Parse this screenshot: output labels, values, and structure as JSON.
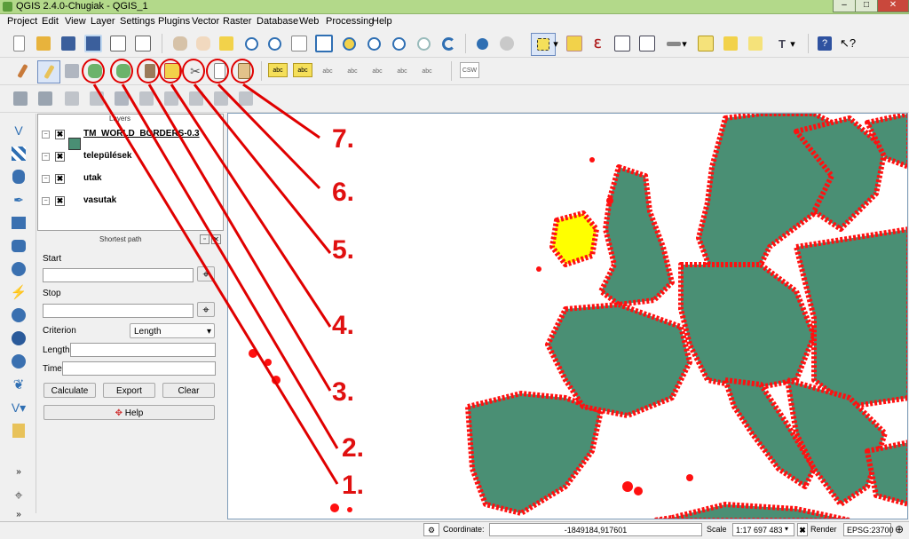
{
  "window": {
    "title": "QGIS 2.4.0-Chugiak - QGIS_1",
    "minimize": "–",
    "maximize": "□",
    "close": "✕"
  },
  "menu": [
    "Project",
    "Edit",
    "View",
    "Layer",
    "Settings",
    "Plugins",
    "Vector",
    "Raster",
    "Database",
    "Web",
    "Processing",
    "Help"
  ],
  "layers_panel": {
    "title": "Layers",
    "layers": [
      {
        "name": "TM_WORLD_BORDERS-0.3",
        "checked": "✖",
        "swatch": "#4a8f74"
      },
      {
        "name": "települések",
        "checked": "✖"
      },
      {
        "name": "utak",
        "checked": "✖"
      },
      {
        "name": "vasutak",
        "checked": "✖"
      }
    ]
  },
  "shortest_path": {
    "title": "Shortest path",
    "start_label": "Start",
    "stop_label": "Stop",
    "criterion_label": "Criterion",
    "criterion_value": "Length",
    "length_label": "Length",
    "time_label": "Time",
    "calculate": "Calculate",
    "export": "Export",
    "clear": "Clear",
    "help": "Help"
  },
  "labels_toolbar": {
    "csw": "CSW",
    "abc": "abc"
  },
  "annotations": [
    "1.",
    "2.",
    "3.",
    "4.",
    "5.",
    "6.",
    "7."
  ],
  "status": {
    "coordinate_label": "Coordinate:",
    "coordinate_value": "-1849184,917601",
    "scale_label": "Scale",
    "scale_value": "1:17 697 483",
    "render_label": "Render",
    "epsg": "EPSG:23700"
  },
  "colors": {
    "map_fill": "#4a8f74",
    "border": "#ff0000",
    "selected": "#ffff00",
    "annotation": "#e01010"
  }
}
